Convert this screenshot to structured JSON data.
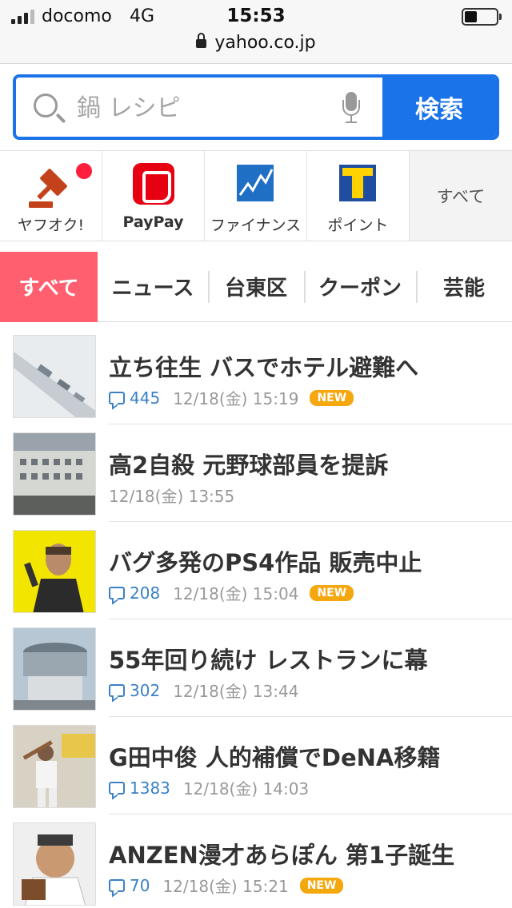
{
  "status_bar": {
    "carrier": "docomo",
    "network": "4G",
    "time": "15:53",
    "battery_level": 0.4,
    "url": "yahoo.co.jp"
  },
  "search": {
    "placeholder": "鍋 レシピ",
    "button_label": "検索"
  },
  "services": [
    {
      "label": "ヤフオク!",
      "icon": "auction-gavel-icon"
    },
    {
      "label": "PayPay",
      "icon": "paypay-logo-icon"
    },
    {
      "label": "ファイナンス",
      "icon": "finance-chart-icon"
    },
    {
      "label": "ポイント",
      "icon": "tpoint-logo-icon"
    },
    {
      "label": "すべて"
    }
  ],
  "tabs": [
    {
      "label": "すべて",
      "active": true
    },
    {
      "label": "ニュース"
    },
    {
      "label": "台東区"
    },
    {
      "label": "クーポン"
    },
    {
      "label": "芸能"
    }
  ],
  "news": [
    {
      "title": "立ち往生 バスでホテル避難へ",
      "comments": "445",
      "date": "12/18(金) 15:19",
      "badge": "NEW"
    },
    {
      "title": "高2自殺 元野球部員を提訴",
      "comments": "",
      "date": "12/18(金) 13:55",
      "badge": ""
    },
    {
      "title": "バグ多発のPS4作品 販売中止",
      "comments": "208",
      "date": "12/18(金) 15:04",
      "badge": "NEW"
    },
    {
      "title": "55年回り続け レストランに幕",
      "comments": "302",
      "date": "12/18(金) 13:44",
      "badge": ""
    },
    {
      "title": "G田中俊 人的補償でDeNA移籍",
      "comments": "1383",
      "date": "12/18(金) 14:03",
      "badge": ""
    },
    {
      "title": "ANZEN漫才あらぽん 第1子誕生",
      "comments": "70",
      "date": "12/18(金) 15:21",
      "badge": "NEW"
    }
  ],
  "colors": {
    "accent_blue": "#1a73e8",
    "active_tab": "#ff5f6e",
    "new_badge": "#f5a70e",
    "comment_blue": "#3a80c5"
  }
}
